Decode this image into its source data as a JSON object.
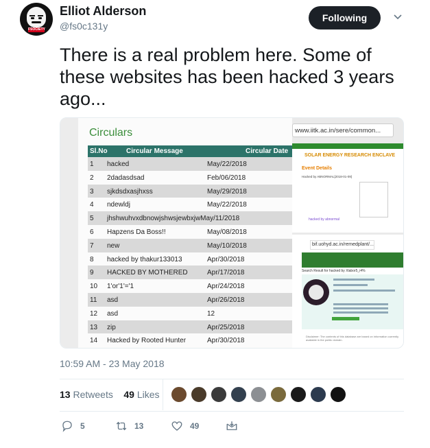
{
  "author": {
    "name": "Elliot Alderson",
    "handle": "@fs0c131y",
    "avatar_tag": "FSOCIETY"
  },
  "follow_button": {
    "label": "Following"
  },
  "tweet": {
    "text": "There is a real problem here. Some of these websites has been hacked 3 years ago...",
    "timestamp": "10:59 AM - 23 May 2018"
  },
  "media": {
    "left": {
      "title": "Circulars",
      "headers": [
        "Sl.No",
        "Circular Message",
        "Circular Date"
      ],
      "rows": [
        [
          "1",
          "hacked",
          "May/22/2018"
        ],
        [
          "2",
          "2dadasdsad",
          "Feb/06/2018"
        ],
        [
          "3",
          "sjkdsdxasjhxss",
          "May/29/2018"
        ],
        [
          "4",
          "ndewldj",
          "May/22/2018"
        ],
        [
          "5",
          "jhshwuhvxdbnowjshwsjewbxjwMay/11/2018",
          ""
        ],
        [
          "6",
          "Hapzens Da Boss!!",
          "May/08/2018"
        ],
        [
          "7",
          "new",
          "May/10/2018"
        ],
        [
          "8",
          "hacked by thakur133013",
          "Apr/30/2018"
        ],
        [
          "9",
          "HACKED BY MOTHERED",
          "Apr/17/2018"
        ],
        [
          "10",
          "1'or'1'='1",
          "Apr/24/2018"
        ],
        [
          "11",
          "asd",
          "Apr/26/2018"
        ],
        [
          "12",
          "asd",
          "12"
        ],
        [
          "13",
          "zip",
          "Apr/25/2018"
        ],
        [
          "14",
          "Hacked by Rooted Hunter",
          "Apr/30/2018"
        ]
      ]
    },
    "right": {
      "url_top": "www.iitk.ac.in/sere/common...",
      "site_title": "SOLAR ENERGY RESEARCH ENCLAVE",
      "event_heading": "Event Details",
      "hacked_line": "Hacked by ABNORMAL[2018-01-09]",
      "hacked_note": "hacked by abnormal",
      "url_bottom": "bif.uohyd.ac.in/remedplant/...",
      "search_line": "Search Result for hacked by Xlabor5_i4%",
      "footer": "Disclaimer: The contents of this database are based on information currently available in the public domain."
    }
  },
  "stats": {
    "retweets_count": "13",
    "retweets_label": "Retweets",
    "likes_count": "49",
    "likes_label": "Likes"
  },
  "likers": [
    {
      "color": "#6b4a2e"
    },
    {
      "color": "#4a3b2a"
    },
    {
      "color": "#3b3b3b"
    },
    {
      "color": "#33404f"
    },
    {
      "color": "#8c8f93"
    },
    {
      "color": "#7a6a3c"
    },
    {
      "color": "#1a1a1a"
    },
    {
      "color": "#2c3a4e"
    },
    {
      "color": "#121212"
    }
  ],
  "actions": {
    "reply_count": "5",
    "retweet_count": "13",
    "like_count": "49"
  }
}
